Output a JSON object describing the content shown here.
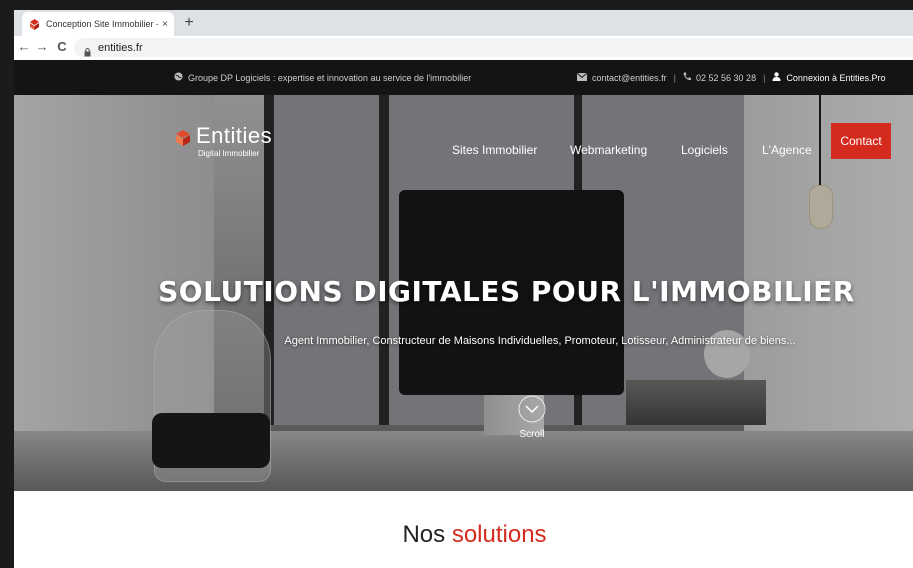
{
  "browser": {
    "tab_title": "Conception Site Immobilier - Log",
    "tab_close": "×",
    "new_tab": "+",
    "back": "←",
    "forward": "→",
    "reload": "C",
    "url": "entities.fr"
  },
  "topbar": {
    "tagline": "Groupe DP Logiciels : expertise et innovation au service de l'immobilier",
    "email": "contact@entities.fr",
    "sep1": "|",
    "phone": "02 52 56 30 28",
    "sep2": "|",
    "login": "Connexion à Entities.Pro"
  },
  "header": {
    "logo_text": "Entities",
    "logo_sub": "Digital Immobilier",
    "nav": [
      "Sites Immobilier",
      "Webmarketing",
      "Logiciels",
      "L'Agence"
    ],
    "contact_button": "Contact"
  },
  "hero": {
    "title": "SOLUTIONS DIGITALES POUR L'IMMOBILIER",
    "subtitle": "Agent Immobilier, Constructeur de Maisons Individuelles, Promoteur, Lotisseur, Administrateur de biens...",
    "scroll_label": "Scroll"
  },
  "solutions": {
    "heading_1": "Nos",
    "heading_2": "solutions"
  },
  "colors": {
    "accent": "#d52b1e",
    "topbar_bg": "#141414"
  }
}
